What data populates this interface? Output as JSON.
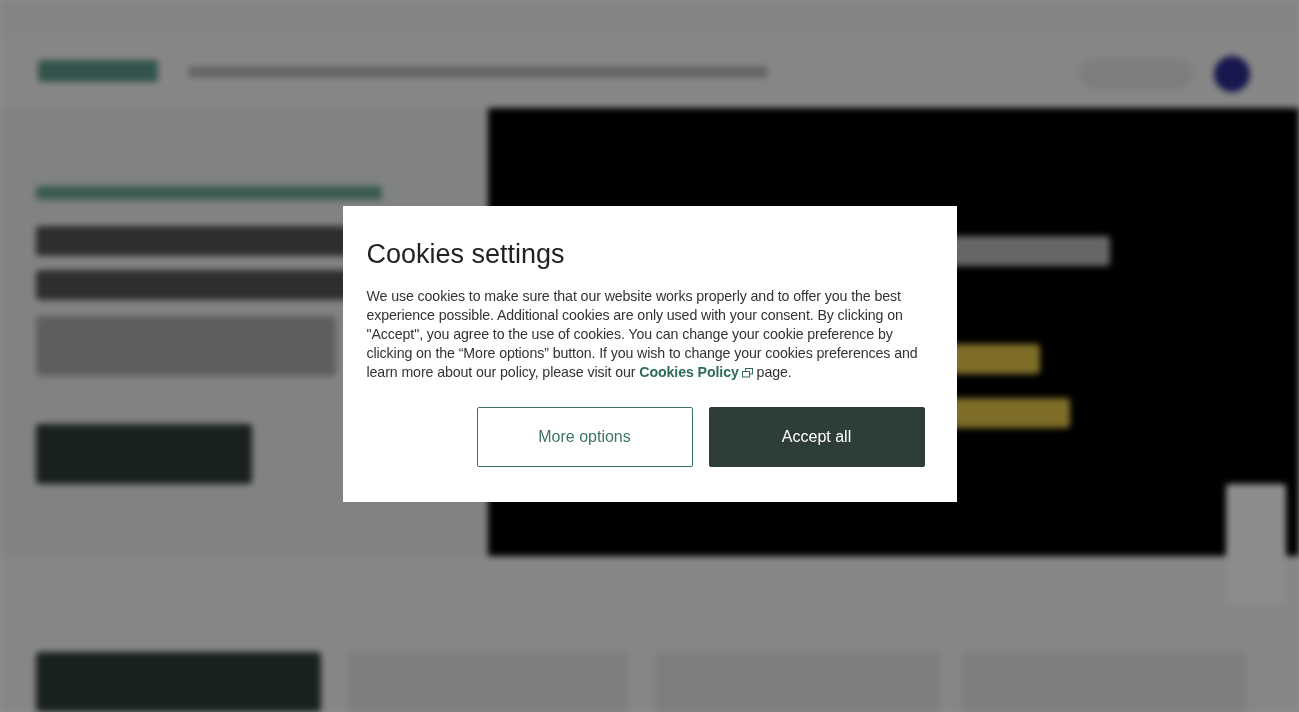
{
  "cookie_dialog": {
    "title": "Cookies settings",
    "body": {
      "text_before": "We use cookies to make sure that our website works properly and to offer you the best experience possible. Additional cookies are only used with your consent. By clicking on \"Accept\", you agree to the use of cookies. You can change your cookie preference by clicking on the “More options” button. If you wish to change your cookies preferences and learn more about our policy, please visit our ",
      "link": "Cookies Policy",
      "text_after": " page."
    },
    "buttons": [
      {
        "label": "More options",
        "kind": "secondary"
      },
      {
        "label": "Accept all",
        "kind": "primary"
      }
    ]
  }
}
